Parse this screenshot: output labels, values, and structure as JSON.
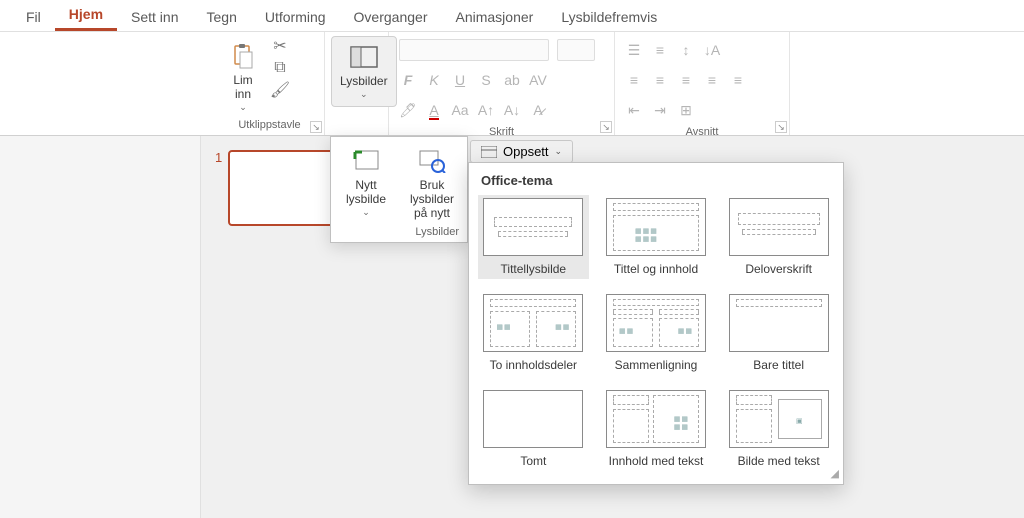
{
  "tabs": {
    "items": [
      "Fil",
      "Hjem",
      "Sett inn",
      "Tegn",
      "Utforming",
      "Overganger",
      "Animasjoner",
      "Lysbildefremvis"
    ],
    "active_index": 1
  },
  "ribbon": {
    "clipboard": {
      "paste_label": "Lim\ninn",
      "group_label": "Utklippstavle"
    },
    "slides": {
      "button_label": "Lysbilder",
      "group_label": "Lysbilder"
    },
    "font": {
      "group_label": "Skrift"
    },
    "paragraph": {
      "group_label": "Avsnitt"
    }
  },
  "slide_panel": {
    "current_number": "1"
  },
  "lys_popup": {
    "new_slide_label": "Nytt\nlysbilde",
    "reuse_label": "Bruk lysbilder\npå nytt",
    "group_label": "Lysbilder"
  },
  "oppsett": {
    "trigger_label": "Oppsett",
    "section_title": "Office-tema",
    "layouts": [
      "Tittellysbilde",
      "Tittel og innhold",
      "Deloverskrift",
      "To innholdsdeler",
      "Sammenligning",
      "Bare tittel",
      "Tomt",
      "Innhold med tekst",
      "Bilde med tekst"
    ],
    "selected_index": 0
  }
}
